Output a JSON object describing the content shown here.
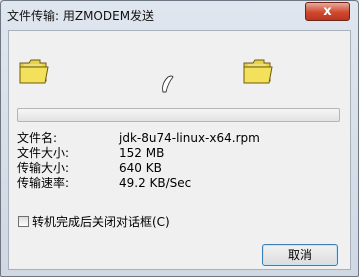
{
  "window": {
    "title": "文件传输: 用ZMODEM发送",
    "close_label": "x"
  },
  "icons": {
    "source": "folder-icon",
    "transfer": "paper-icon",
    "destination": "folder-icon"
  },
  "progress": {
    "fraction": 0.0
  },
  "info": {
    "rows": [
      {
        "label": "文件名:",
        "value": "jdk-8u74-linux-x64.rpm"
      },
      {
        "label": "文件大小:",
        "value": "152 MB"
      },
      {
        "label": "传输大小:",
        "value": "640 KB"
      },
      {
        "label": "传输速率:",
        "value": "49.2 KB/Sec"
      }
    ]
  },
  "options": {
    "close_when_done_label": "转机完成后关闭对话框(C)",
    "checked": false
  },
  "buttons": {
    "cancel_label": "取消"
  }
}
